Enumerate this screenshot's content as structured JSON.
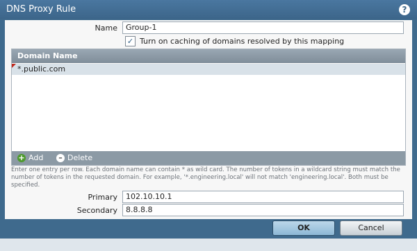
{
  "dialog": {
    "title": "DNS Proxy Rule",
    "help_icon": "question-circle-icon"
  },
  "form": {
    "name_label": "Name",
    "name_value": "Group-1",
    "caching_checked": true,
    "caching_label": "Turn on caching of domains resolved by this mapping",
    "primary_label": "Primary",
    "primary_value": "102.10.10.1",
    "secondary_label": "Secondary",
    "secondary_value": "8.8.8.8"
  },
  "grid": {
    "column_header": "Domain Name",
    "rows": [
      "*.public.com"
    ],
    "add_label": "Add",
    "delete_label": "Delete"
  },
  "help_text": "Enter one entry per row. Each domain name can contain * as wild card. The number of tokens in a wildcard string must match the number of tokens in the requested domain. For example, '*.engineering.local' will not match 'engineering.local'. Both must be specified.",
  "buttons": {
    "ok": "OK",
    "cancel": "Cancel"
  },
  "colors": {
    "titlebar": "#3d6688",
    "ok_button": "#a7c9e2",
    "grid_header": "#8c9aa5"
  }
}
